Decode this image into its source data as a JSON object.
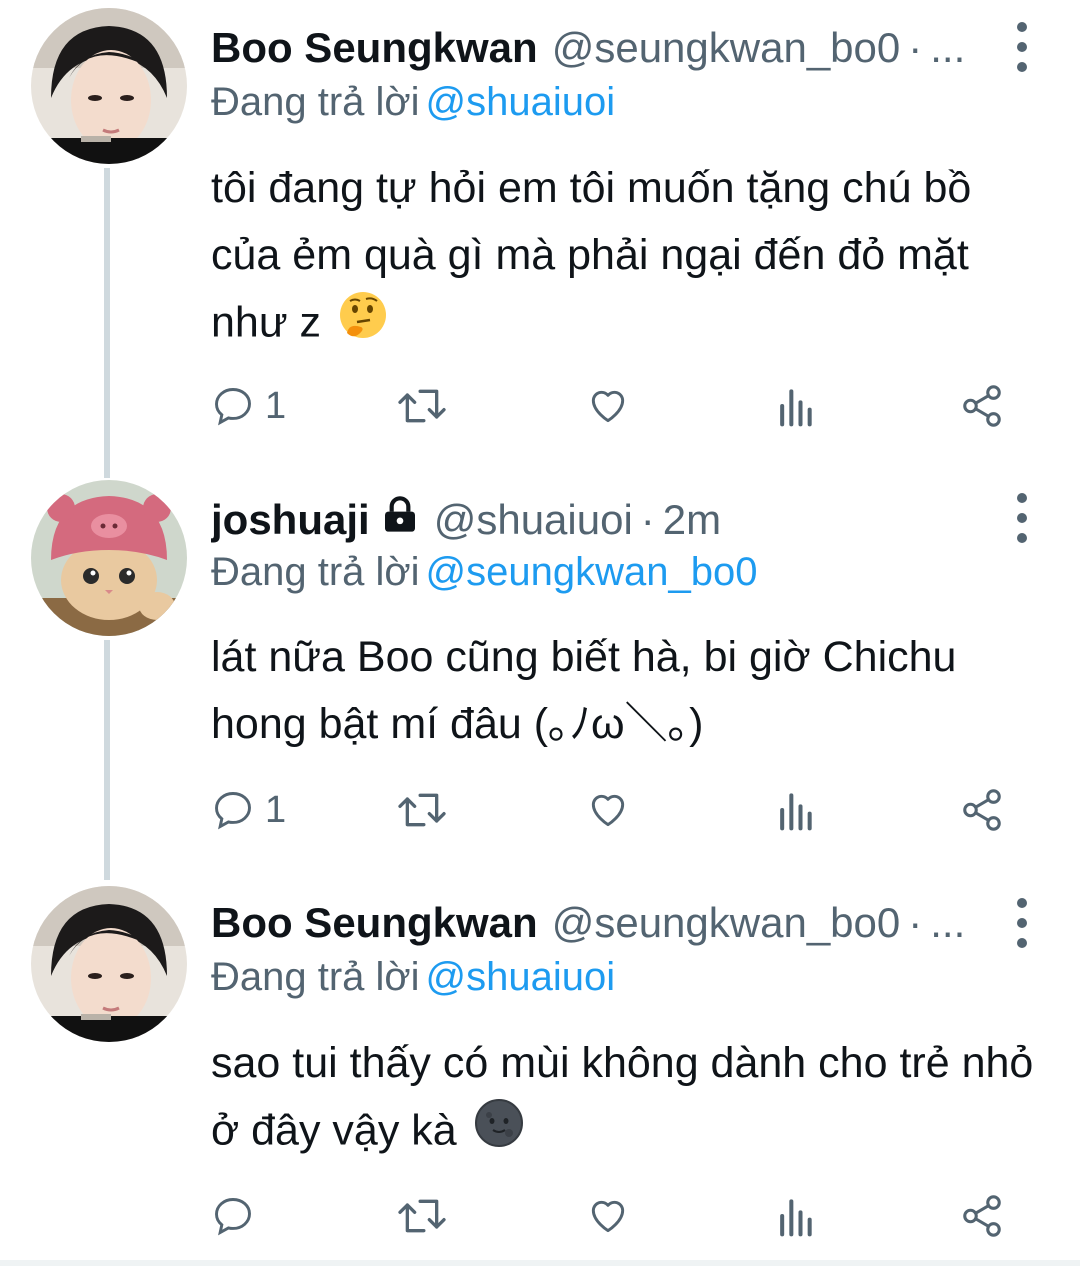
{
  "tweets": [
    {
      "name": "Boo Seungkwan",
      "handle": "@seungkwan_bo0",
      "separator": "·",
      "time": "...",
      "reply_prefix": "Đang trả lời",
      "reply_to": "@shuaiuoi",
      "text": "tôi đang tự hỏi em tôi muốn tặng chú bồ của ẻm quà gì mà phải ngại đến đỏ mặt như z",
      "emoji": "thinking-face",
      "reply_count": "1",
      "avatar": "boy-portrait"
    },
    {
      "name": "joshuaji",
      "locked": true,
      "handle": "@shuaiuoi",
      "separator": "·",
      "time": "2m",
      "reply_prefix": "Đang trả lời",
      "reply_to": "@seungkwan_bo0",
      "text": "lát nữa Boo cũng biết hà, bi giờ Chichu hong bật mí đâu (｡ﾉω＼｡)",
      "emoji": "",
      "reply_count": "1",
      "avatar": "cat-in-pink-hat"
    },
    {
      "name": "Boo Seungkwan",
      "handle": "@seungkwan_bo0",
      "separator": "·",
      "time": "...",
      "reply_prefix": "Đang trả lời",
      "reply_to": "@shuaiuoi",
      "text": "sao tui thấy có mùi không dành cho trẻ nhỏ ở đây vậy kà",
      "emoji": "new-moon-face",
      "reply_count": "",
      "avatar": "boy-portrait"
    }
  ],
  "colors": {
    "text": "#0f1419",
    "secondary": "#536471",
    "link": "#1d9bf0",
    "thread_line": "#cfd9de"
  }
}
